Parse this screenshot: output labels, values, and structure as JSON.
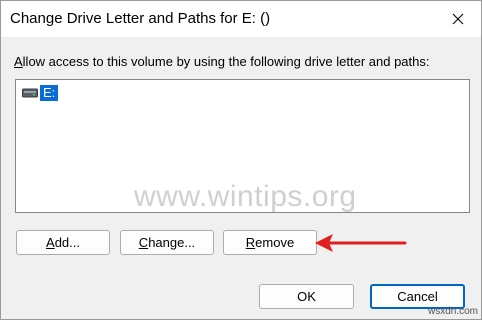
{
  "window": {
    "title": "Change Drive Letter and Paths for E: ()"
  },
  "description": {
    "prefix": "",
    "accesskey": "A",
    "rest": "llow access to this volume by using the following drive letter and paths:"
  },
  "list": {
    "items": [
      {
        "label": "E:",
        "icon": "drive-icon",
        "selected": true
      }
    ]
  },
  "buttons": {
    "add": {
      "accesskey": "A",
      "rest": "dd..."
    },
    "change": {
      "accesskey": "C",
      "rest": "hange..."
    },
    "remove": {
      "accesskey": "R",
      "rest": "emove"
    },
    "ok": "OK",
    "cancel": "Cancel"
  },
  "watermark": "www.wintips.org",
  "corner_watermark": "wsxdn.com",
  "colors": {
    "selection": "#0a6cd6",
    "arrow": "#e02020",
    "default_button_border": "#0067c0"
  }
}
